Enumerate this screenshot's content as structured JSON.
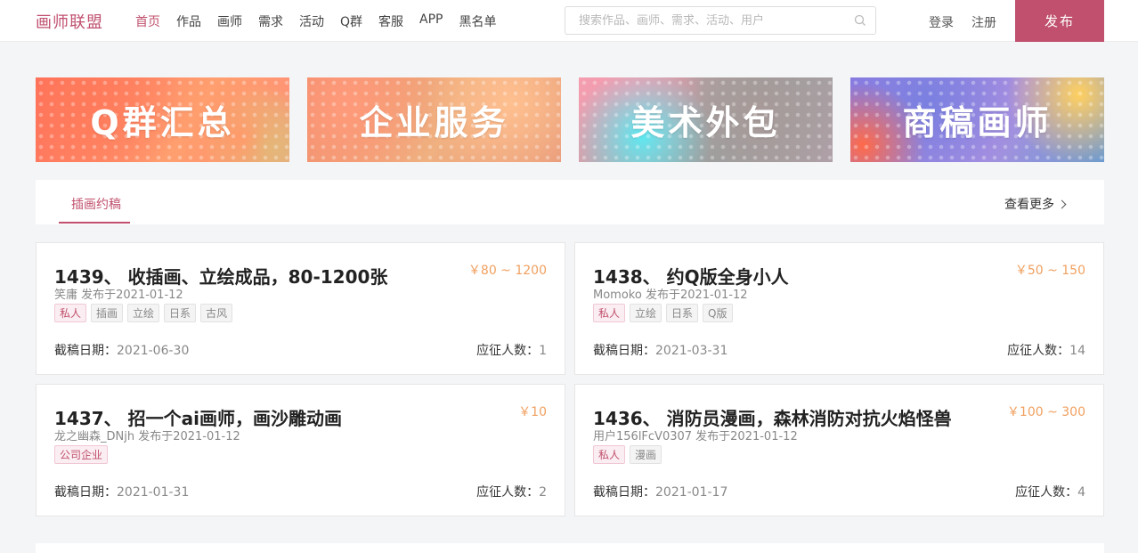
{
  "header": {
    "logo": "画师联盟",
    "nav": [
      "首页",
      "作品",
      "画师",
      "需求",
      "活动",
      "Q群",
      "客服",
      "APP",
      "黑名单"
    ],
    "search_placeholder": "搜索作品、画师、需求、活动、用户",
    "login": "登录",
    "register": "注册",
    "publish": "发布"
  },
  "banners": [
    "Q群汇总",
    "企业服务",
    "美术外包",
    "商稿画师"
  ],
  "section": {
    "tab": "插画约稿",
    "more": "查看更多"
  },
  "cards": [
    {
      "title": "1439、 收插画、立绘成品，80-1200张",
      "price": "￥80 ~ 1200",
      "meta": "笑庸 发布于2021-01-12",
      "tags": [
        "私人",
        "插画",
        "立绘",
        "日系",
        "古风"
      ],
      "deadline_label": "截稿日期：",
      "deadline": "2021-06-30",
      "applicants_label": "应征人数：",
      "applicants": "1"
    },
    {
      "title": "1438、 约Q版全身小人",
      "price": "￥50 ~ 150",
      "meta": "Momoko 发布于2021-01-12",
      "tags": [
        "私人",
        "立绘",
        "日系",
        "Q版"
      ],
      "deadline_label": "截稿日期：",
      "deadline": "2021-03-31",
      "applicants_label": "应征人数：",
      "applicants": "14"
    },
    {
      "title": "1437、 招一个ai画师，画沙雕动画",
      "price": "￥10",
      "meta": "龙之幽森_DNjh 发布于2021-01-12",
      "tags": [
        "公司企业"
      ],
      "deadline_label": "截稿日期：",
      "deadline": "2021-01-31",
      "applicants_label": "应征人数：",
      "applicants": "2"
    },
    {
      "title": "1436、 消防员漫画，森林消防对抗火焰怪兽",
      "price": "￥100 ~ 300",
      "meta": "用户156lFcV0307 发布于2021-01-12",
      "tags": [
        "私人",
        "漫画"
      ],
      "deadline_label": "截稿日期：",
      "deadline": "2021-01-17",
      "applicants_label": "应征人数：",
      "applicants": "4"
    }
  ],
  "colors": {
    "accent": "#c0506d",
    "price": "#f0a060"
  }
}
